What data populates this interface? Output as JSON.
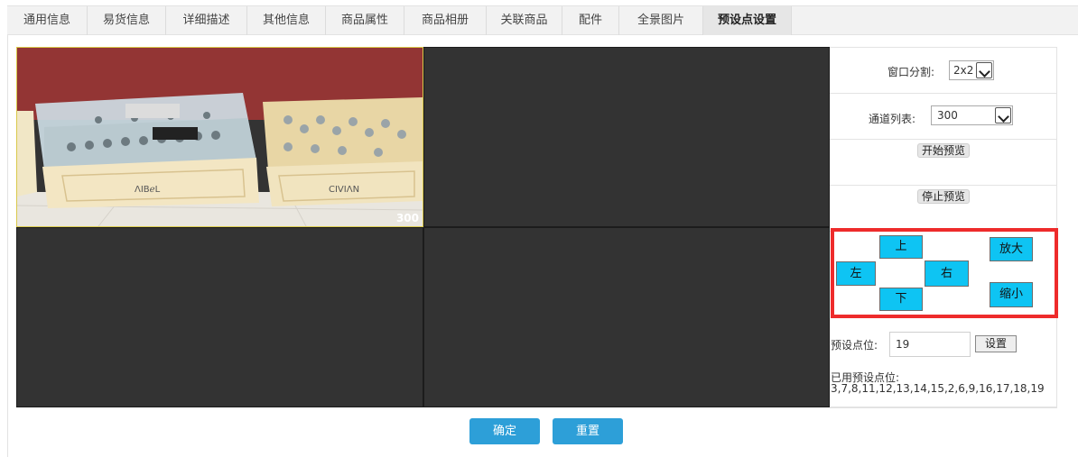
{
  "tabs": [
    {
      "label": "通用信息"
    },
    {
      "label": "易货信息"
    },
    {
      "label": "详细描述"
    },
    {
      "label": "其他信息"
    },
    {
      "label": "商品属性"
    },
    {
      "label": "商品相册"
    },
    {
      "label": "关联商品"
    },
    {
      "label": "配件"
    },
    {
      "label": "全景图片"
    },
    {
      "label": "预设点设置"
    }
  ],
  "active_tab": "预设点设置",
  "video": {
    "channel_label": "300"
  },
  "panel": {
    "split_label": "窗口分割:",
    "split_value": "2x2",
    "channel_list_label": "通道列表:",
    "channel_value": "300",
    "start_preview": "开始预览",
    "stop_preview": "停止预览"
  },
  "ptz": {
    "up": "上",
    "down": "下",
    "left": "左",
    "right": "右",
    "zoom_in": "放大",
    "zoom_out": "缩小"
  },
  "preset": {
    "label": "预设点位:",
    "value": "19",
    "set_button": "设置",
    "used_title": "已用预设点位:",
    "used_list": "3,7,8,11,12,13,14,15,2,6,9,16,17,18,19"
  },
  "actions": {
    "confirm": "确定",
    "reset": "重置"
  },
  "colors": {
    "accent_blue": "#2d9fd8",
    "ptz_cyan": "#0ec4f3",
    "highlight_red": "#ee2b2b"
  }
}
